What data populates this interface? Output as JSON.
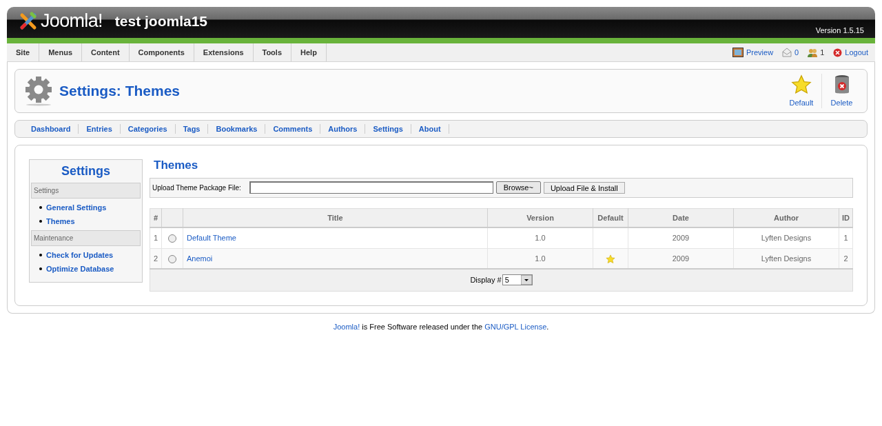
{
  "header": {
    "logo_text": "Joomla!",
    "site_name": "test joomla15",
    "version": "Version 1.5.15"
  },
  "menu": [
    "Site",
    "Menus",
    "Content",
    "Components",
    "Extensions",
    "Tools",
    "Help"
  ],
  "status": [
    {
      "kind": "preview",
      "label": "Preview"
    },
    {
      "kind": "messages",
      "label": "0"
    },
    {
      "kind": "users",
      "label": "1"
    },
    {
      "kind": "logout",
      "label": "Logout"
    }
  ],
  "toolbar": {
    "title": "Settings: Themes",
    "buttons": [
      {
        "kind": "default",
        "label": "Default"
      },
      {
        "kind": "delete",
        "label": "Delete"
      }
    ]
  },
  "submenu": [
    "Dashboard",
    "Entries",
    "Categories",
    "Tags",
    "Bookmarks",
    "Comments",
    "Authors",
    "Settings",
    "About"
  ],
  "sidebar": {
    "title": "Settings",
    "groups": [
      {
        "heading": "Settings",
        "items": [
          "General Settings",
          "Themes"
        ]
      },
      {
        "heading": "Maintenance",
        "items": [
          "Check for Updates",
          "Optimize Database"
        ]
      }
    ]
  },
  "main": {
    "title": "Themes",
    "upload_label": "Upload Theme Package File:",
    "browse_button": "Browse~",
    "upload_button": "Upload File & Install",
    "columns": [
      "#",
      "Title",
      "Version",
      "Default",
      "Date",
      "Author",
      "ID"
    ],
    "rows": [
      {
        "num": "1",
        "selected": false,
        "title": "Default Theme",
        "version": "1.0",
        "default": false,
        "date": "2009",
        "author": "Lyften Designs",
        "id": "1"
      },
      {
        "num": "2",
        "selected": false,
        "title": "Anemoi",
        "version": "1.0",
        "default": true,
        "date": "2009",
        "author": "Lyften Designs",
        "id": "2"
      }
    ],
    "display_label": "Display #",
    "display_value": "5"
  },
  "footer": {
    "link1": "Joomla!",
    "text": " is Free Software released under the ",
    "link2": "GNU/GPL License",
    "end": "."
  }
}
